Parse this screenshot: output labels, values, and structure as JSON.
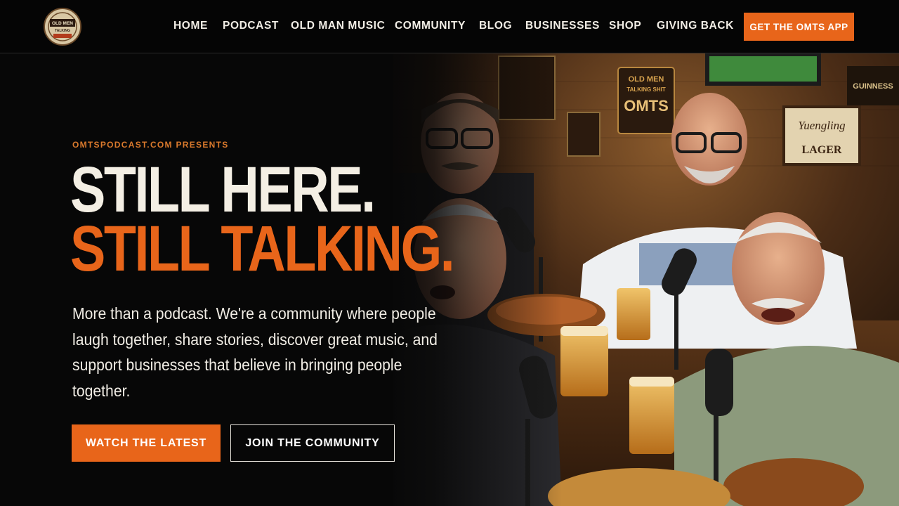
{
  "header": {
    "logo_text": "OLD MEN TALKING SHIT",
    "nav": [
      "HOME",
      "PODCAST",
      "OLD MAN MUSIC",
      "COMMUNITY",
      "BLOG",
      "BUSINESSES",
      "SHOP",
      "GIVING BACK"
    ],
    "cta_label": "GET THE OMTS APP"
  },
  "hero": {
    "eyebrow": "OMTSPODCAST.COM PRESENTS",
    "headline_line1": "STILL HERE.",
    "headline_line2": "STILL TALKING.",
    "lede": "More than a podcast. We're a community where people laugh together, share stories, discover great music, and support businesses that believe in bringing people together.",
    "primary_button": "WATCH THE LATEST",
    "secondary_button": "JOIN THE COMMUNITY",
    "photo_signs": {
      "omts_sign": [
        "OLD MEN",
        "TALKING SHIT",
        "OMTS"
      ],
      "lager_sign": [
        "Yuengling",
        "LAGER"
      ],
      "guinness_sign": "GUINNESS"
    }
  },
  "colors": {
    "accent": "#e8651a",
    "background": "#070707",
    "headline_light": "#f4efe4"
  }
}
